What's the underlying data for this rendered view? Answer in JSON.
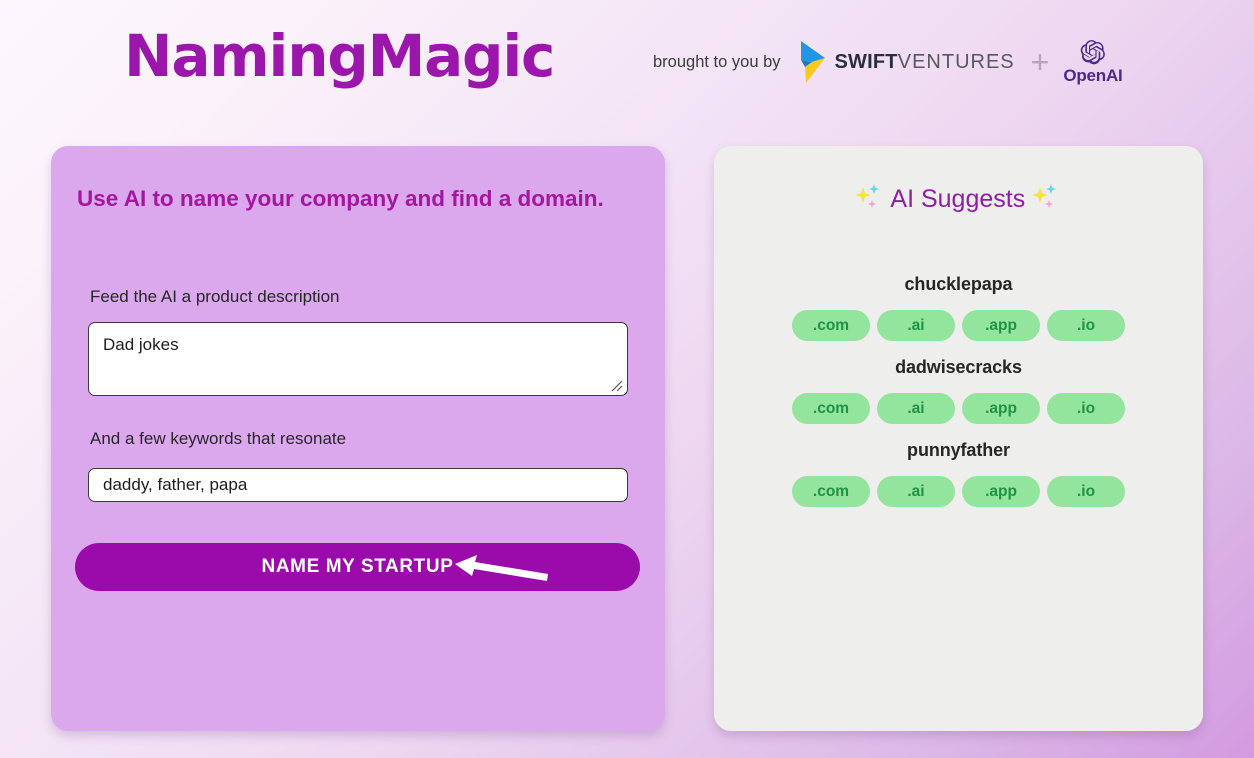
{
  "header": {
    "logo": "NamingMagic",
    "brought_text": "brought to you by",
    "swift": {
      "bold_part": "SWIFT",
      "light_part": "VENTURES",
      "mark_icon": "swift-arrow-icon"
    },
    "plus": "+",
    "openai": {
      "word": "OpenAI",
      "mark_icon": "openai-knot-icon"
    }
  },
  "left_panel": {
    "heading": "Use AI to name your company and find a domain.",
    "description_label": "Feed the AI a product description",
    "description_value": "Dad jokes",
    "description_placeholder": "Feed the AI a product description",
    "keywords_label": "And a few keywords that resonate",
    "keywords_value": "daddy, father, papa",
    "keywords_placeholder": "And a few keywords that resonate",
    "submit_label": "NAME MY STARTUP",
    "annotation_icon": "arrow-pointer-icon"
  },
  "right_panel": {
    "title": "AI Suggests",
    "sparkle_icon": "sparkles-icon",
    "suggestions": [
      {
        "name": "chucklepapa",
        "domains": [
          ".com",
          ".ai",
          ".app",
          ".io"
        ]
      },
      {
        "name": "dadwisecracks",
        "domains": [
          ".com",
          ".ai",
          ".app",
          ".io"
        ]
      },
      {
        "name": "punnyfather",
        "domains": [
          ".com",
          ".ai",
          ".app",
          ".io"
        ]
      }
    ]
  },
  "colors": {
    "brand_purple": "#9b16ab",
    "heading_purple": "#a3179f",
    "left_card_bg": "#dba8ee",
    "right_card_bg": "#eeeeec",
    "button_purple": "#9b0aab",
    "pill_bg": "#93e49c",
    "pill_text": "#209246",
    "openai_purple": "#4a2b8c",
    "swift_blue": "#2196e3",
    "swift_yellow": "#fbc91b"
  }
}
